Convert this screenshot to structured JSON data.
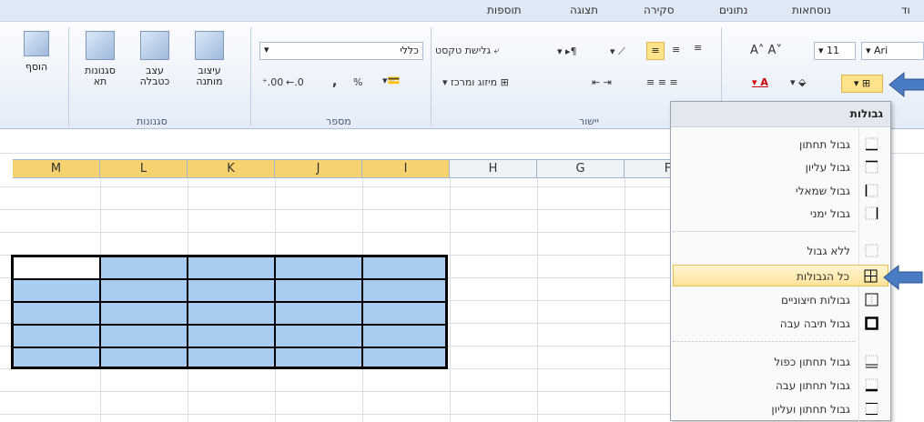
{
  "tabs": [
    "תוספות",
    "תצוגה",
    "סקירה",
    "נתונים",
    "נוסחאות",
    "וד"
  ],
  "ribbon": {
    "insert_label": "הוסף",
    "styles_label": "סגנונות\nתא",
    "format_table_label": "עצב\nכטבלה",
    "conditional_label": "עיצוב\nמותנה",
    "number_format": "כללי",
    "percent": "%",
    "comma": ",",
    "dec_inc": ".00",
    "dec_dec": "←.0",
    "wrap_text": "גלישת טקסט",
    "merge_center": "מיזוג ומרכז",
    "font_size": "11",
    "font_name": "Ari",
    "group_styles": "סגנונות",
    "group_number": "מספר",
    "group_alignment": "יישור"
  },
  "columns": [
    "M",
    "L",
    "K",
    "J",
    "I",
    "H",
    "G",
    "F"
  ],
  "menu": {
    "title": "גבולות",
    "items": [
      {
        "label": "גבול תחתון",
        "icon": "border-bottom-icon"
      },
      {
        "label": "גבול עליון",
        "icon": "border-top-icon"
      },
      {
        "label": "גבול שמאלי",
        "icon": "border-left-icon"
      },
      {
        "label": "גבול ימני",
        "icon": "border-right-icon"
      },
      {
        "label": "ללא גבול",
        "icon": "no-border-icon"
      },
      {
        "label": "כל הגבולות",
        "icon": "all-borders-icon"
      },
      {
        "label": "גבולות חיצוניים",
        "icon": "outside-borders-icon"
      },
      {
        "label": "גבול תיבה עבה",
        "icon": "thick-box-border-icon"
      },
      {
        "label": "גבול תחתון כפול",
        "icon": "double-bottom-border-icon"
      },
      {
        "label": "גבול תחתון עבה",
        "icon": "thick-bottom-border-icon"
      },
      {
        "label": "גבול תחתון ועליון",
        "icon": "top-bottom-border-icon"
      }
    ]
  },
  "colors": {
    "accent": "#4a7cc4",
    "selection": "#a8cdf1",
    "header_sel": "#f7d36f"
  }
}
